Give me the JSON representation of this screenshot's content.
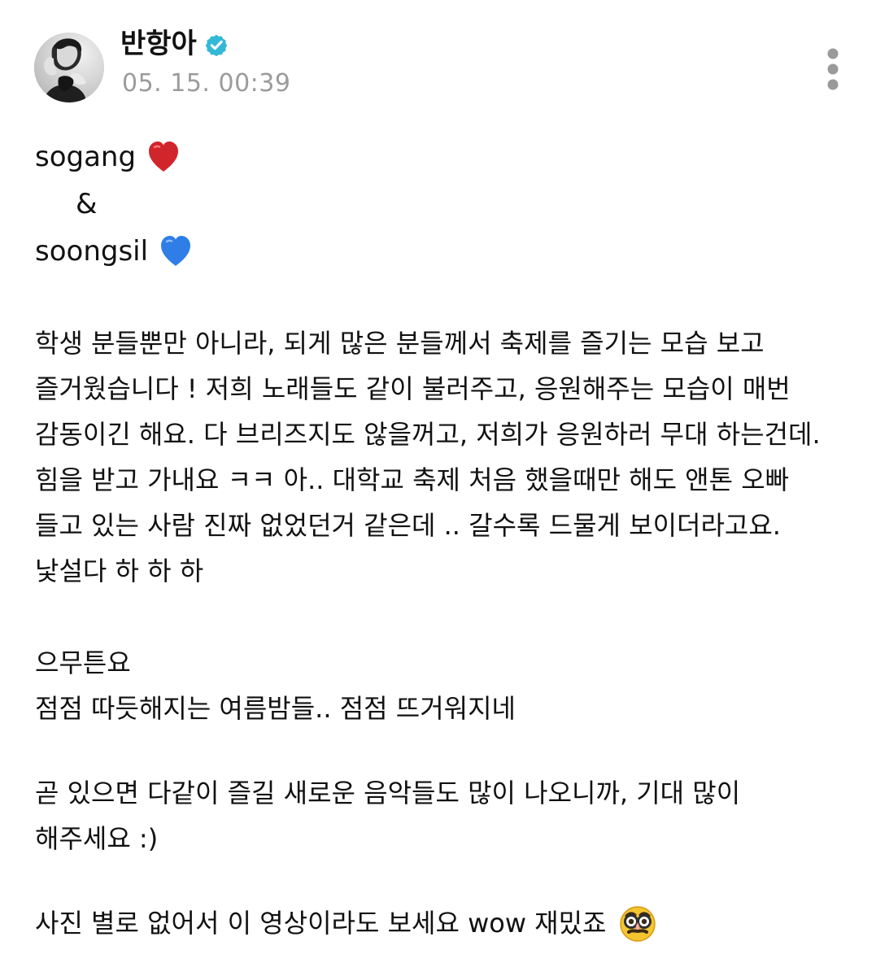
{
  "author": {
    "name": "반항아",
    "verified_icon": "verified-badge-icon",
    "verified_color": "#33b8d6",
    "avatar_icon": "avatar-photo"
  },
  "post_time": "05. 15. 00:39",
  "menu": {
    "icon": "more-vertical-icon",
    "color": "#9a9a9a"
  },
  "body": {
    "line1": "sogang",
    "line1_icon": "red-heart-icon",
    "line1_color": "#d0252b",
    "line2": "&",
    "line3": "soongsil",
    "line3_icon": "blue-heart-icon",
    "line3_color": "#2f7ee8",
    "paragraph1": "학생 분들뿐만 아니라, 되게 많은 분들께서 축제를 즐기는 모습 보고 즐거웠습니다 ! 저희 노래들도 같이 불러주고, 응원해주는 모습이 매번 감동이긴 해요. 다 브리즈지도 않을꺼고, 저희가 응원하러 무대 하는건데. 힘을 받고 가내요 ㅋㅋ 아.. 대학교 축제 처음 했을때만 해도 앤톤 오빠 들고 있는 사람 진짜 없었던거 같은데 .. 갈수록 드물게 보이더라고요. 낯설다 하 하 하",
    "paragraph2_line1": "으무튼요",
    "paragraph2_line2": "점점 따듯해지는 여름밤들.. 점점 뜨거워지네",
    "paragraph3": "곧 있으면 다같이 즐길 새로운 음악들도 많이 나오니까, 기대 많이 해주세요 :)",
    "paragraph4": "사진 별로 없어서 이 영상이라도 보세요 wow 재밌죠",
    "paragraph4_icon": "disguised-face-emoji-icon"
  }
}
